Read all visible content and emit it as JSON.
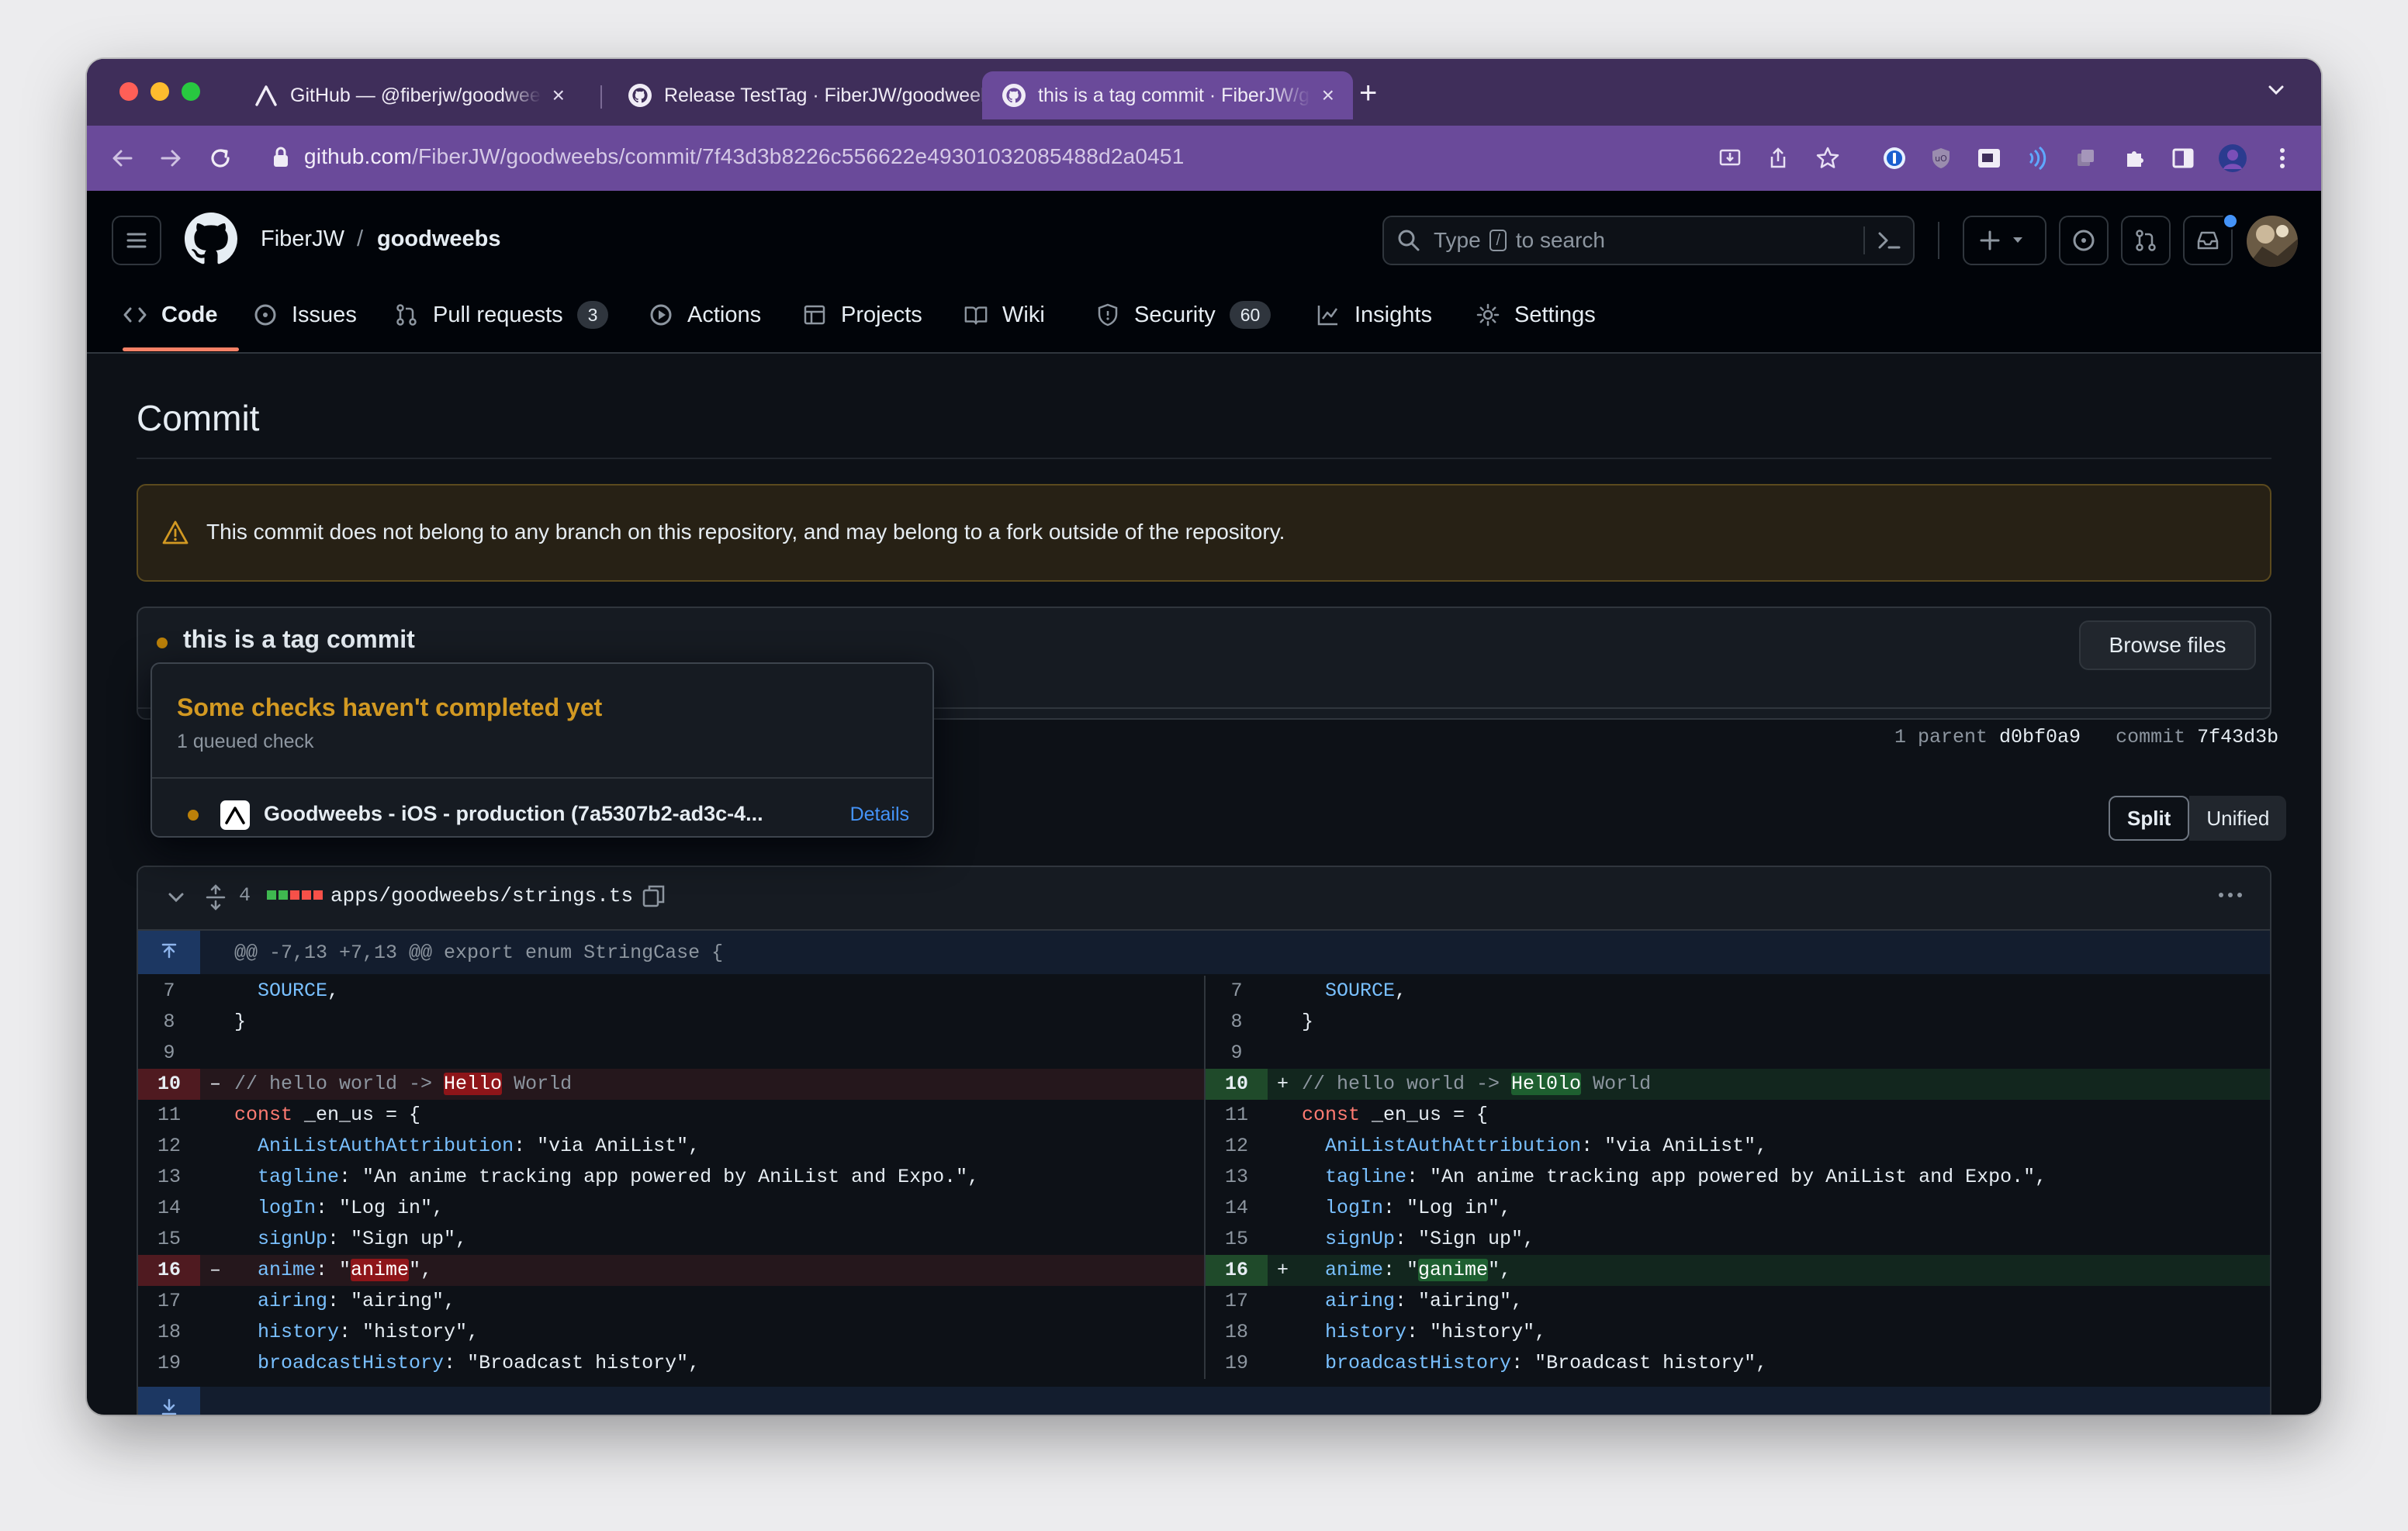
{
  "browser": {
    "tabs": [
      {
        "title": "GitHub — @fiberjw/goodweebs",
        "active": false
      },
      {
        "title": "Release TestTag · FiberJW/goodweebs",
        "active": false
      },
      {
        "title": "this is a tag commit · FiberJW/goodweebs",
        "active": true
      }
    ],
    "new_tab": "+",
    "url_host": "github.com",
    "url_path": "/FiberJW/goodweebs/commit/7f43d3b8226c556622e49301032085488d2a0451"
  },
  "header": {
    "owner": "FiberJW",
    "separator": "/",
    "repo": "goodweebs",
    "search_prefix": "Type",
    "search_key": "/",
    "search_suffix": "to search"
  },
  "repo_nav": {
    "code": "Code",
    "issues": "Issues",
    "pulls": "Pull requests",
    "pulls_count": "3",
    "actions": "Actions",
    "projects": "Projects",
    "wiki": "Wiki",
    "security": "Security",
    "security_count": "60",
    "insights": "Insights",
    "settings": "Settings"
  },
  "page": {
    "title": "Commit",
    "flash": "This commit does not belong to any branch on this repository, and may belong to a fork outside of the repository.",
    "commit_title": "this is a tag commit",
    "browse_files": "Browse files",
    "parent_label": "1 parent",
    "parent_sha": "d0bf0a9",
    "commit_label": "commit",
    "commit_sha": "7f43d3b",
    "stub_letter": "S",
    "view_split": "Split",
    "view_unified": "Unified"
  },
  "checks_popup": {
    "title": "Some checks haven't completed yet",
    "subtitle": "1 queued check",
    "check_name": "Goodweebs - iOS - production (7a5307b2-ad3c-4...",
    "details": "Details"
  },
  "diff": {
    "changes": "4",
    "file_path": "apps/goodweebs/strings.ts",
    "hunk_header": "@@ -7,13 +7,13 @@ export enum StringCase {",
    "left": [
      {
        "ln": "7",
        "type": "ctx",
        "code": "  SOURCE,"
      },
      {
        "ln": "8",
        "type": "ctx",
        "code": "}"
      },
      {
        "ln": "9",
        "type": "ctx",
        "code": ""
      },
      {
        "ln": "10",
        "type": "del",
        "code": "// hello world -> Hello World"
      },
      {
        "ln": "11",
        "type": "ctx",
        "code": "const _en_us = {"
      },
      {
        "ln": "12",
        "type": "ctx",
        "code": "  AniListAuthAttribution: \"via AniList\","
      },
      {
        "ln": "13",
        "type": "ctx",
        "code": "  tagline: \"An anime tracking app powered by AniList and Expo.\","
      },
      {
        "ln": "14",
        "type": "ctx",
        "code": "  logIn: \"Log in\","
      },
      {
        "ln": "15",
        "type": "ctx",
        "code": "  signUp: \"Sign up\","
      },
      {
        "ln": "16",
        "type": "del",
        "code": "  anime: \"anime\","
      },
      {
        "ln": "17",
        "type": "ctx",
        "code": "  airing: \"airing\","
      },
      {
        "ln": "18",
        "type": "ctx",
        "code": "  history: \"history\","
      },
      {
        "ln": "19",
        "type": "ctx",
        "code": "  broadcastHistory: \"Broadcast history\","
      }
    ],
    "right": [
      {
        "ln": "7",
        "type": "ctx",
        "code": "  SOURCE,"
      },
      {
        "ln": "8",
        "type": "ctx",
        "code": "}"
      },
      {
        "ln": "9",
        "type": "ctx",
        "code": ""
      },
      {
        "ln": "10",
        "type": "add",
        "code": "// hello world -> Hel0lo World"
      },
      {
        "ln": "11",
        "type": "ctx",
        "code": "const _en_us = {"
      },
      {
        "ln": "12",
        "type": "ctx",
        "code": "  AniListAuthAttribution: \"via AniList\","
      },
      {
        "ln": "13",
        "type": "ctx",
        "code": "  tagline: \"An anime tracking app powered by AniList and Expo.\","
      },
      {
        "ln": "14",
        "type": "ctx",
        "code": "  logIn: \"Log in\","
      },
      {
        "ln": "15",
        "type": "ctx",
        "code": "  signUp: \"Sign up\","
      },
      {
        "ln": "16",
        "type": "add",
        "code": "  anime: \"ganime\","
      },
      {
        "ln": "17",
        "type": "ctx",
        "code": "  airing: \"airing\","
      },
      {
        "ln": "18",
        "type": "ctx",
        "code": "  history: \"history\","
      },
      {
        "ln": "19",
        "type": "ctx",
        "code": "  broadcastHistory: \"Broadcast history\","
      }
    ]
  }
}
